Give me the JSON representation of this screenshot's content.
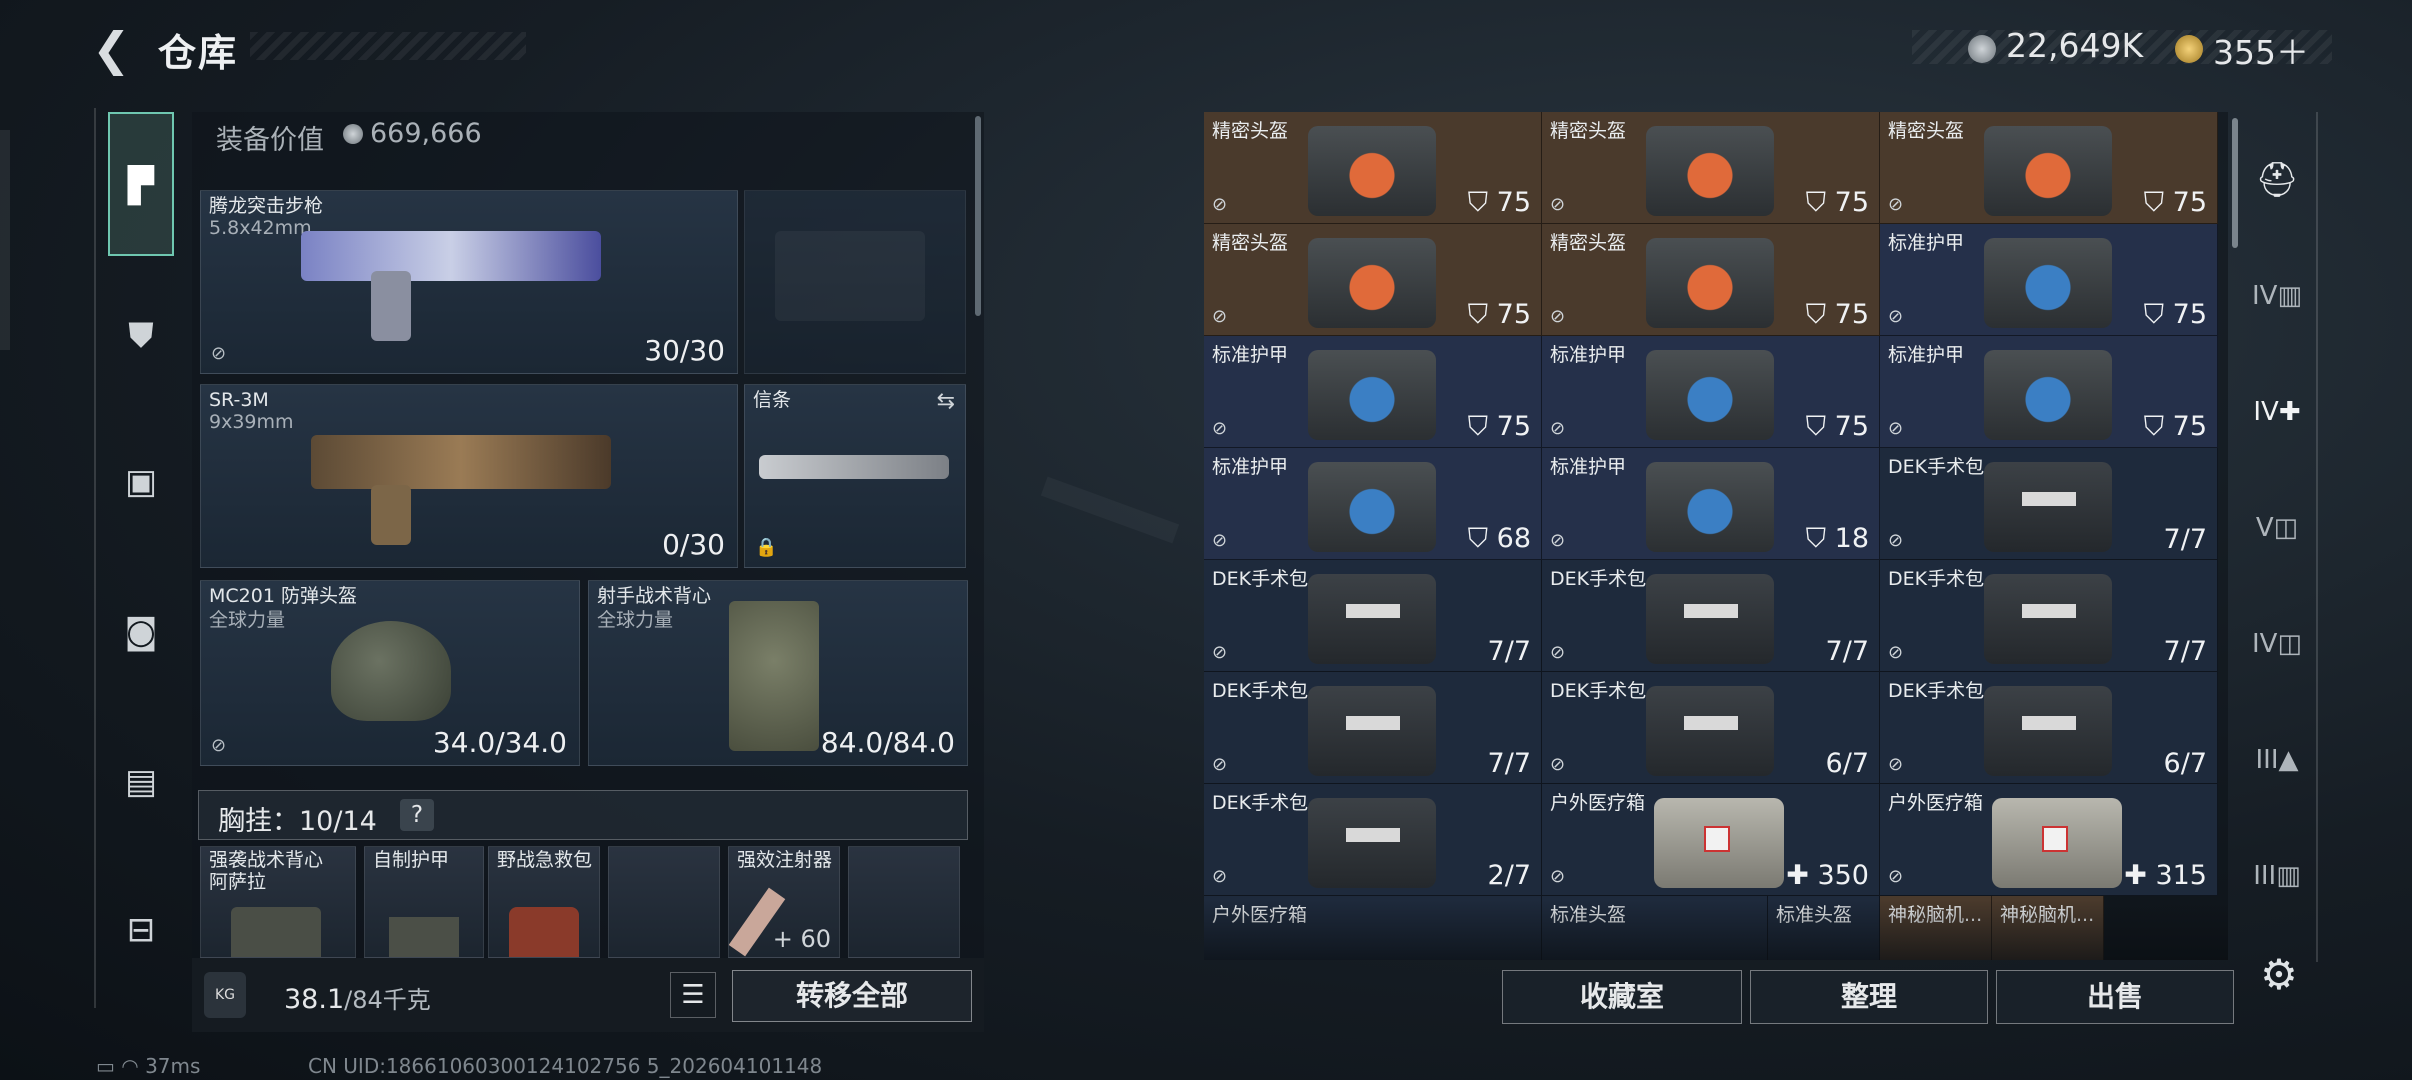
{
  "header": {
    "back_icon": "chevron-left-icon",
    "title": "仓库",
    "currency_silver": "22,649K",
    "currency_gold": "355＋"
  },
  "left_sidebar": {
    "items": [
      "pistol-icon",
      "vest-icon",
      "backpack-icon",
      "bag-icon",
      "case-icon",
      "toolbox-icon"
    ]
  },
  "equipment": {
    "value_label": "装备价值",
    "value": "669,666",
    "primary": {
      "name": "腾龙突击步枪",
      "caliber": "5.8x42mm",
      "ammo": "30/30"
    },
    "secondary": {
      "name": "SR-3M",
      "caliber": "9x39mm",
      "ammo": "0/30"
    },
    "melee": {
      "name": "信条",
      "icon": "swap-icon",
      "lock_icon": "lock-icon"
    },
    "helmet": {
      "name": "MC201 防弹头盔",
      "brand": "全球力量",
      "durability": "34.0/34.0"
    },
    "vest": {
      "name": "射手战术背心",
      "brand": "全球力量",
      "durability": "84.0/84.0"
    },
    "chest_rig": {
      "label": "胸挂：10/14",
      "help": "?"
    },
    "chest_items": [
      {
        "name": "强袭战术背心\n阿萨拉"
      },
      {
        "name": "自制护甲"
      },
      {
        "name": "野战急救包"
      },
      {
        "name": ""
      },
      {
        "name": "强效注射器",
        "value": "+ 60"
      },
      {
        "name": ""
      }
    ],
    "weight": "38.1",
    "weight_max": "/84千克",
    "kg_label": "KG",
    "transfer_all": "转移全部"
  },
  "storage": {
    "items": [
      {
        "name": "精密头盔",
        "value": "75",
        "kind": "helm"
      },
      {
        "name": "精密头盔",
        "value": "75",
        "kind": "helm"
      },
      {
        "name": "精密头盔",
        "value": "75",
        "kind": "helm"
      },
      {
        "name": "精密头盔",
        "value": "75",
        "kind": "helm"
      },
      {
        "name": "精密头盔",
        "value": "75",
        "kind": "helm"
      },
      {
        "name": "标准护甲",
        "value": "75",
        "kind": "armor"
      },
      {
        "name": "标准护甲",
        "value": "75",
        "kind": "armor"
      },
      {
        "name": "标准护甲",
        "value": "75",
        "kind": "armor"
      },
      {
        "name": "标准护甲",
        "value": "75",
        "kind": "armor"
      },
      {
        "name": "标准护甲",
        "value": "68",
        "kind": "armor"
      },
      {
        "name": "标准护甲",
        "value": "18",
        "kind": "armor"
      },
      {
        "name": "DEK手术包",
        "value": "7/7",
        "kind": "med"
      },
      {
        "name": "DEK手术包",
        "value": "7/7",
        "kind": "med"
      },
      {
        "name": "DEK手术包",
        "value": "7/7",
        "kind": "med"
      },
      {
        "name": "DEK手术包",
        "value": "7/7",
        "kind": "med"
      },
      {
        "name": "DEK手术包",
        "value": "7/7",
        "kind": "med"
      },
      {
        "name": "DEK手术包",
        "value": "6/7",
        "kind": "med"
      },
      {
        "name": "DEK手术包",
        "value": "6/7",
        "kind": "med"
      },
      {
        "name": "DEK手术包",
        "value": "2/7",
        "kind": "med"
      },
      {
        "name": "户外医疗箱",
        "value": "350",
        "kind": "outdoor"
      },
      {
        "name": "户外医疗箱",
        "value": "315",
        "kind": "outdoor"
      }
    ],
    "partial_row": [
      "户外医疗箱",
      "标准头盔",
      "标准头盔",
      "神秘脑机...",
      "神秘脑机..."
    ],
    "colors": {
      "helm_bg": "#4a3a2c",
      "armor_bg": "#25304a",
      "med_bg": "#1e2a3c"
    },
    "buttons": {
      "collection": "收藏室",
      "organize": "整理",
      "sell": "出售"
    }
  },
  "right_sidebar": {
    "items": [
      "helmet-icon",
      "tier-IV-case-icon",
      "tier-IV-add-case-icon",
      "tier-V-case-icon",
      "tier-IV-case-icon",
      "tier-III-case-icon",
      "tier-III-case-icon"
    ]
  },
  "status": {
    "ping": "37ms",
    "uid": "CN UID:18661060300124102756 5_202604101148"
  }
}
